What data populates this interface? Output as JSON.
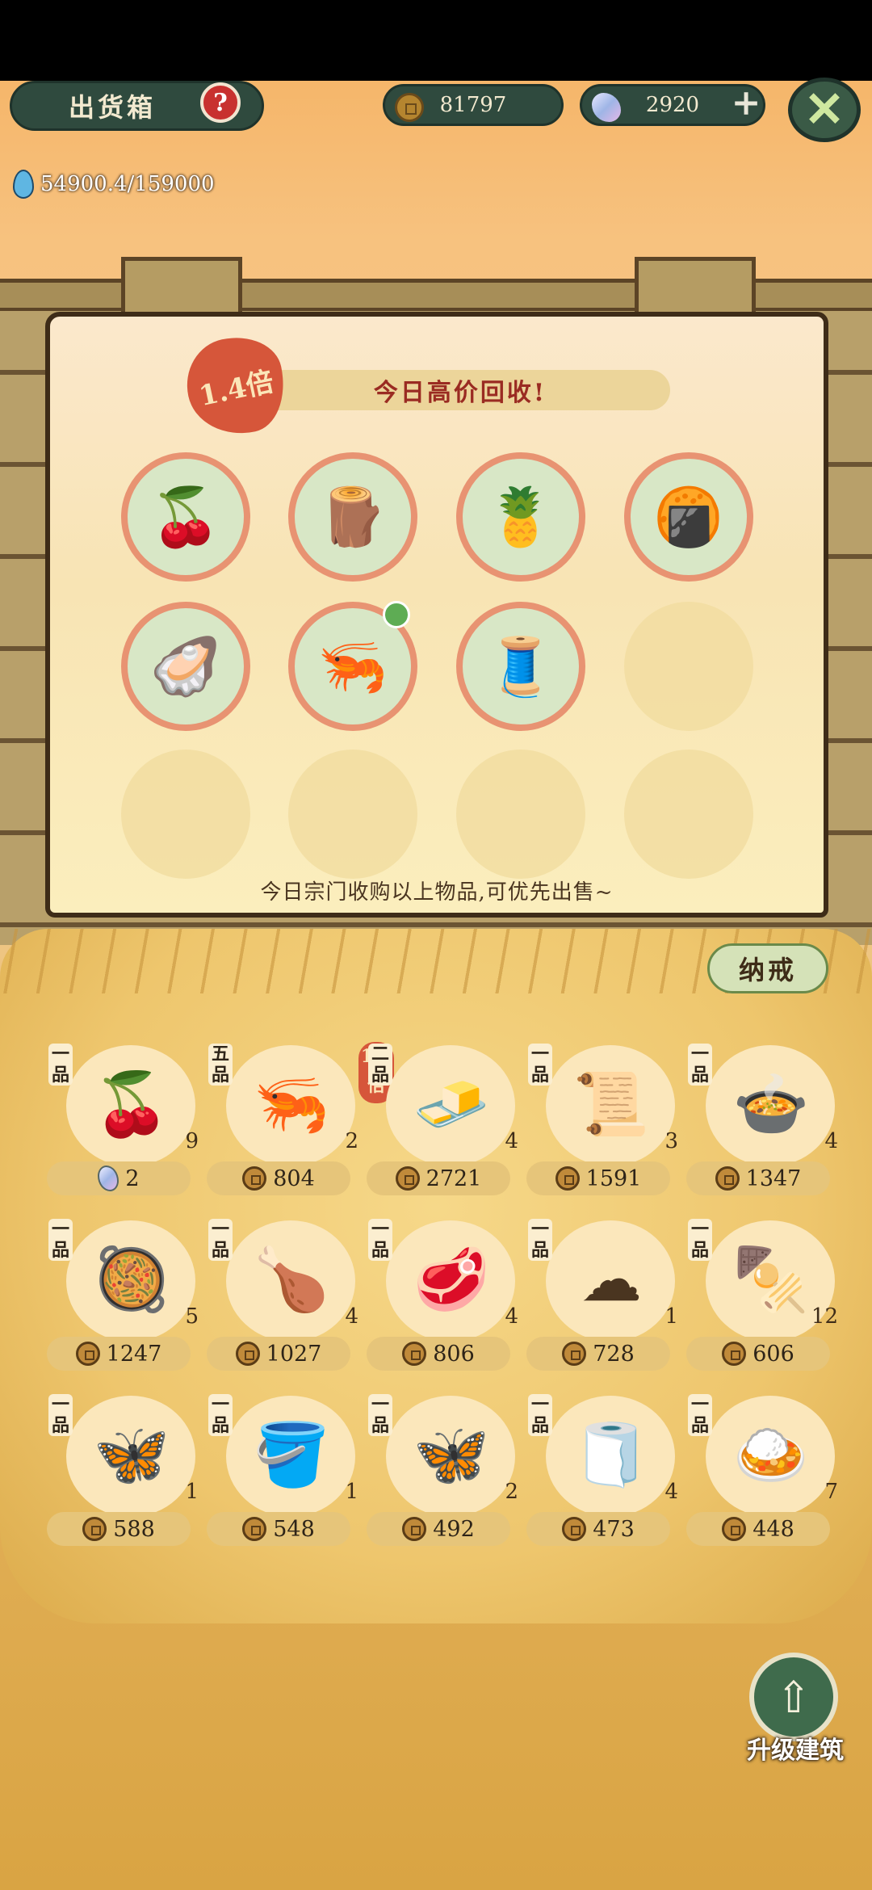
{
  "header": {
    "title": "出货箱",
    "help_icon": "help-icon",
    "coins": "81797",
    "gems": "2920",
    "add_label": "+",
    "close_icon": "close-icon"
  },
  "water": {
    "value": "54900.4/159000",
    "icon": "water-drop-icon"
  },
  "poster": {
    "multiplier": "1.4倍",
    "banner": "今日高价回收!",
    "note": "今日宗门收购以上物品,可优先出售~",
    "slots": [
      {
        "icon": "lychee-icon",
        "glyph": "🍒"
      },
      {
        "icon": "cinnamon-icon",
        "glyph": "🪵"
      },
      {
        "icon": "pineapple-icon",
        "glyph": "🍍"
      },
      {
        "icon": "crab-roe-dish-icon",
        "glyph": "🍘"
      },
      {
        "icon": "scallop-icon",
        "glyph": "🦪"
      },
      {
        "icon": "blue-shrimp-icon",
        "glyph": "🦐"
      },
      {
        "icon": "silk-spool-icon",
        "glyph": "🧵"
      }
    ]
  },
  "storage": {
    "tag": "纳戒",
    "items": [
      {
        "grade": "一品",
        "icon": "lychee-icon",
        "glyph": "🍒",
        "count": "9",
        "price": "2",
        "currency": "gem"
      },
      {
        "grade": "五品",
        "icon": "blue-shrimp-icon",
        "glyph": "🦐",
        "count": "2",
        "price": "804",
        "currency": "coin",
        "mult": "1.4倍"
      },
      {
        "grade": "二品",
        "icon": "tofu-dish-icon",
        "glyph": "🧈",
        "count": "4",
        "price": "2721",
        "currency": "coin"
      },
      {
        "grade": "一品",
        "icon": "scroll-icon",
        "glyph": "📜",
        "count": "3",
        "price": "1591",
        "currency": "coin"
      },
      {
        "grade": "一品",
        "icon": "clay-pot-soup-icon",
        "glyph": "🍲",
        "count": "4",
        "price": "1347",
        "currency": "coin"
      },
      {
        "grade": "一品",
        "icon": "spicy-fish-icon",
        "glyph": "🥘",
        "count": "5",
        "price": "1247",
        "currency": "coin"
      },
      {
        "grade": "一品",
        "icon": "roast-duck-icon",
        "glyph": "🍗",
        "count": "4",
        "price": "1027",
        "currency": "coin"
      },
      {
        "grade": "一品",
        "icon": "cured-meat-icon",
        "glyph": "🥩",
        "count": "4",
        "price": "806",
        "currency": "coin"
      },
      {
        "grade": "一品",
        "icon": "cotton-icon",
        "glyph": "☁",
        "count": "1",
        "price": "728",
        "currency": "coin"
      },
      {
        "grade": "一品",
        "icon": "skewer-icon",
        "glyph": "🍢",
        "count": "12",
        "price": "606",
        "currency": "coin"
      },
      {
        "grade": "一品",
        "icon": "gray-butterfly-icon",
        "glyph": "🦋",
        "count": "1",
        "price": "588",
        "currency": "coin"
      },
      {
        "grade": "一品",
        "icon": "milk-bucket-icon",
        "glyph": "🪣",
        "count": "1",
        "price": "548",
        "currency": "coin"
      },
      {
        "grade": "一品",
        "icon": "dark-butterfly-icon",
        "glyph": "🦋",
        "count": "2",
        "price": "492",
        "currency": "coin"
      },
      {
        "grade": "一品",
        "icon": "cloth-roll-icon",
        "glyph": "🧻",
        "count": "4",
        "price": "473",
        "currency": "coin"
      },
      {
        "grade": "一品",
        "icon": "sweet-sour-pork-icon",
        "glyph": "🍛",
        "count": "7",
        "price": "448",
        "currency": "coin"
      }
    ]
  },
  "upgrade": {
    "label": "升级建筑",
    "icon": "upgrade-building-icon",
    "glyph": "⇧"
  }
}
